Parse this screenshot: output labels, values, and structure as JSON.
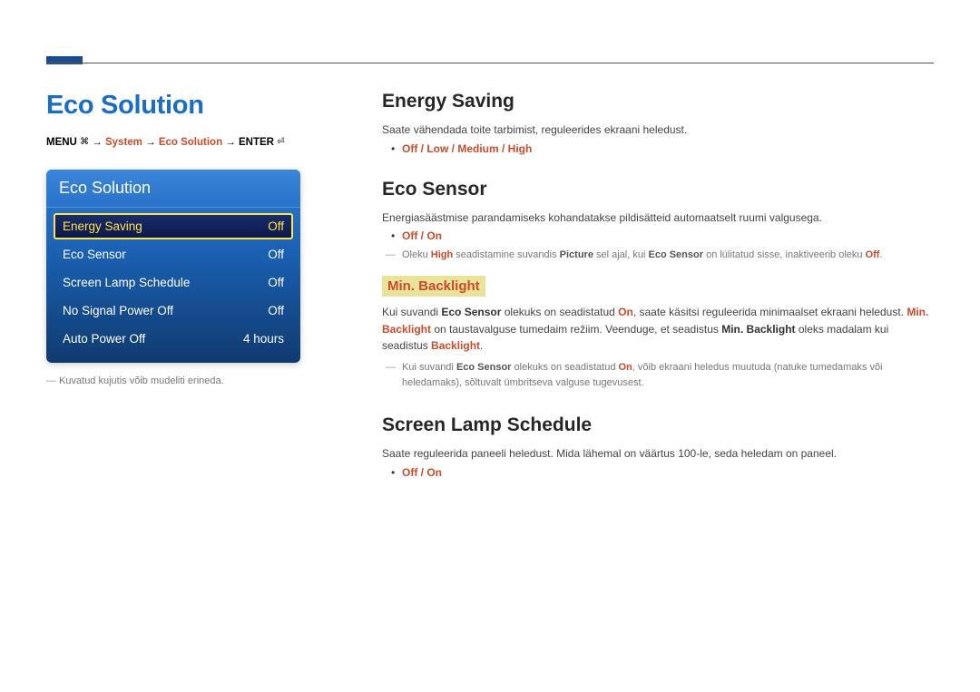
{
  "page_title": "Eco Solution",
  "breadcrumb": {
    "menu_label": "MENU",
    "menu_icon": "⌘",
    "arrow": "→",
    "system": "System",
    "eco": "Eco Solution",
    "enter_label": "ENTER",
    "enter_icon": "⏎"
  },
  "panel": {
    "header": "Eco Solution",
    "items": [
      {
        "label": "Energy Saving",
        "value": "Off",
        "selected": true
      },
      {
        "label": "Eco Sensor",
        "value": "Off",
        "selected": false
      },
      {
        "label": "Screen Lamp Schedule",
        "value": "Off",
        "selected": false
      },
      {
        "label": "No Signal Power Off",
        "value": "Off",
        "selected": false
      },
      {
        "label": "Auto Power Off",
        "value": "4 hours",
        "selected": false
      }
    ],
    "caption": "Kuvatud kujutis võib mudeliti erineda."
  },
  "sections": {
    "energy_saving": {
      "title": "Energy Saving",
      "desc": "Saate vähendada toite tarbimist, reguleerides ekraani heledust.",
      "options": "Off / Low / Medium / High"
    },
    "eco_sensor": {
      "title": "Eco Sensor",
      "desc": "Energiasäästmise parandamiseks kohandatakse pildisätteid automaatselt ruumi valgusega.",
      "options": "Off / On",
      "note_parts": {
        "pre": "Oleku ",
        "hl1": "High",
        "mid1": " seadistamine suvandis ",
        "bl1": "Picture",
        "mid2": " sel ajal, kui ",
        "bl2": "Eco Sensor",
        "mid3": " on lülitatud sisse, inaktiveerib oleku ",
        "hl2": "Off",
        "end": "."
      },
      "min_backlight_label": "Min. Backlight",
      "min_backlight_desc_parts": {
        "pre": "Kui suvandi ",
        "bl1": "Eco Sensor",
        "mid1": " olekuks on seadistatud ",
        "hl1": "On",
        "mid2": ", saate käsitsi reguleerida minimaalset ekraani heledust. ",
        "hl2": "Min. Backlight",
        "mid3": " on taustavalguse tumedaim režiim. Veenduge, et seadistus ",
        "bl2": "Min. Backlight",
        "mid4": " oleks madalam kui seadistus ",
        "hl3": "Backlight",
        "end": "."
      },
      "note2_parts": {
        "pre": "Kui suvandi ",
        "bl1": "Eco Sensor",
        "mid1": " olekuks on seadistatud ",
        "hl1": "On",
        "mid2": ", võib ekraani heledus muutuda (natuke tumedamaks või heledamaks), sõltuvalt ümbritseva valguse tugevusest."
      }
    },
    "screen_lamp": {
      "title": "Screen Lamp Schedule",
      "desc": "Saate reguleerida paneeli heledust. Mida lähemal on väärtus 100-le, seda heledam on paneel.",
      "options": "Off / On"
    }
  }
}
